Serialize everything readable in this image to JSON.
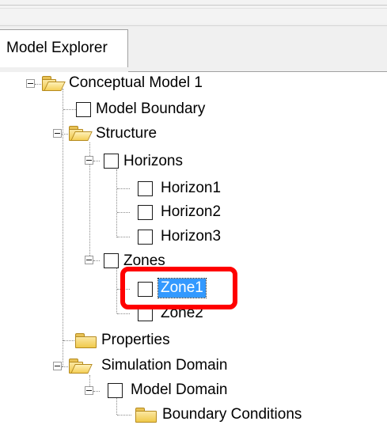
{
  "panel": {
    "tab_label": "Model Explorer"
  },
  "tree": [
    {
      "label": "Conceptual Model 1",
      "kind": "folder-open",
      "expanded": true
    },
    {
      "label": "Model Boundary",
      "kind": "checkbox"
    },
    {
      "label": "Structure",
      "kind": "folder-open",
      "expanded": true
    },
    {
      "label": "Horizons",
      "kind": "checkbox",
      "expanded": true
    },
    {
      "label": "Horizon1",
      "kind": "checkbox"
    },
    {
      "label": "Horizon2",
      "kind": "checkbox"
    },
    {
      "label": "Horizon3",
      "kind": "checkbox"
    },
    {
      "label": "Zones",
      "kind": "checkbox",
      "expanded": true
    },
    {
      "label": "Zone1",
      "kind": "checkbox",
      "selected": true
    },
    {
      "label": "Zone2",
      "kind": "checkbox"
    },
    {
      "label": "Properties",
      "kind": "folder-closed"
    },
    {
      "label": "Simulation Domain",
      "kind": "folder-open",
      "expanded": true
    },
    {
      "label": "Model Domain",
      "kind": "checkbox",
      "expanded": true
    },
    {
      "label": "Boundary Conditions",
      "kind": "folder-closed"
    }
  ],
  "highlight": {
    "color": "#ff0000",
    "target": "Zone1"
  },
  "colors": {
    "selection": "#3399ff",
    "folder": "#f0c94a"
  }
}
